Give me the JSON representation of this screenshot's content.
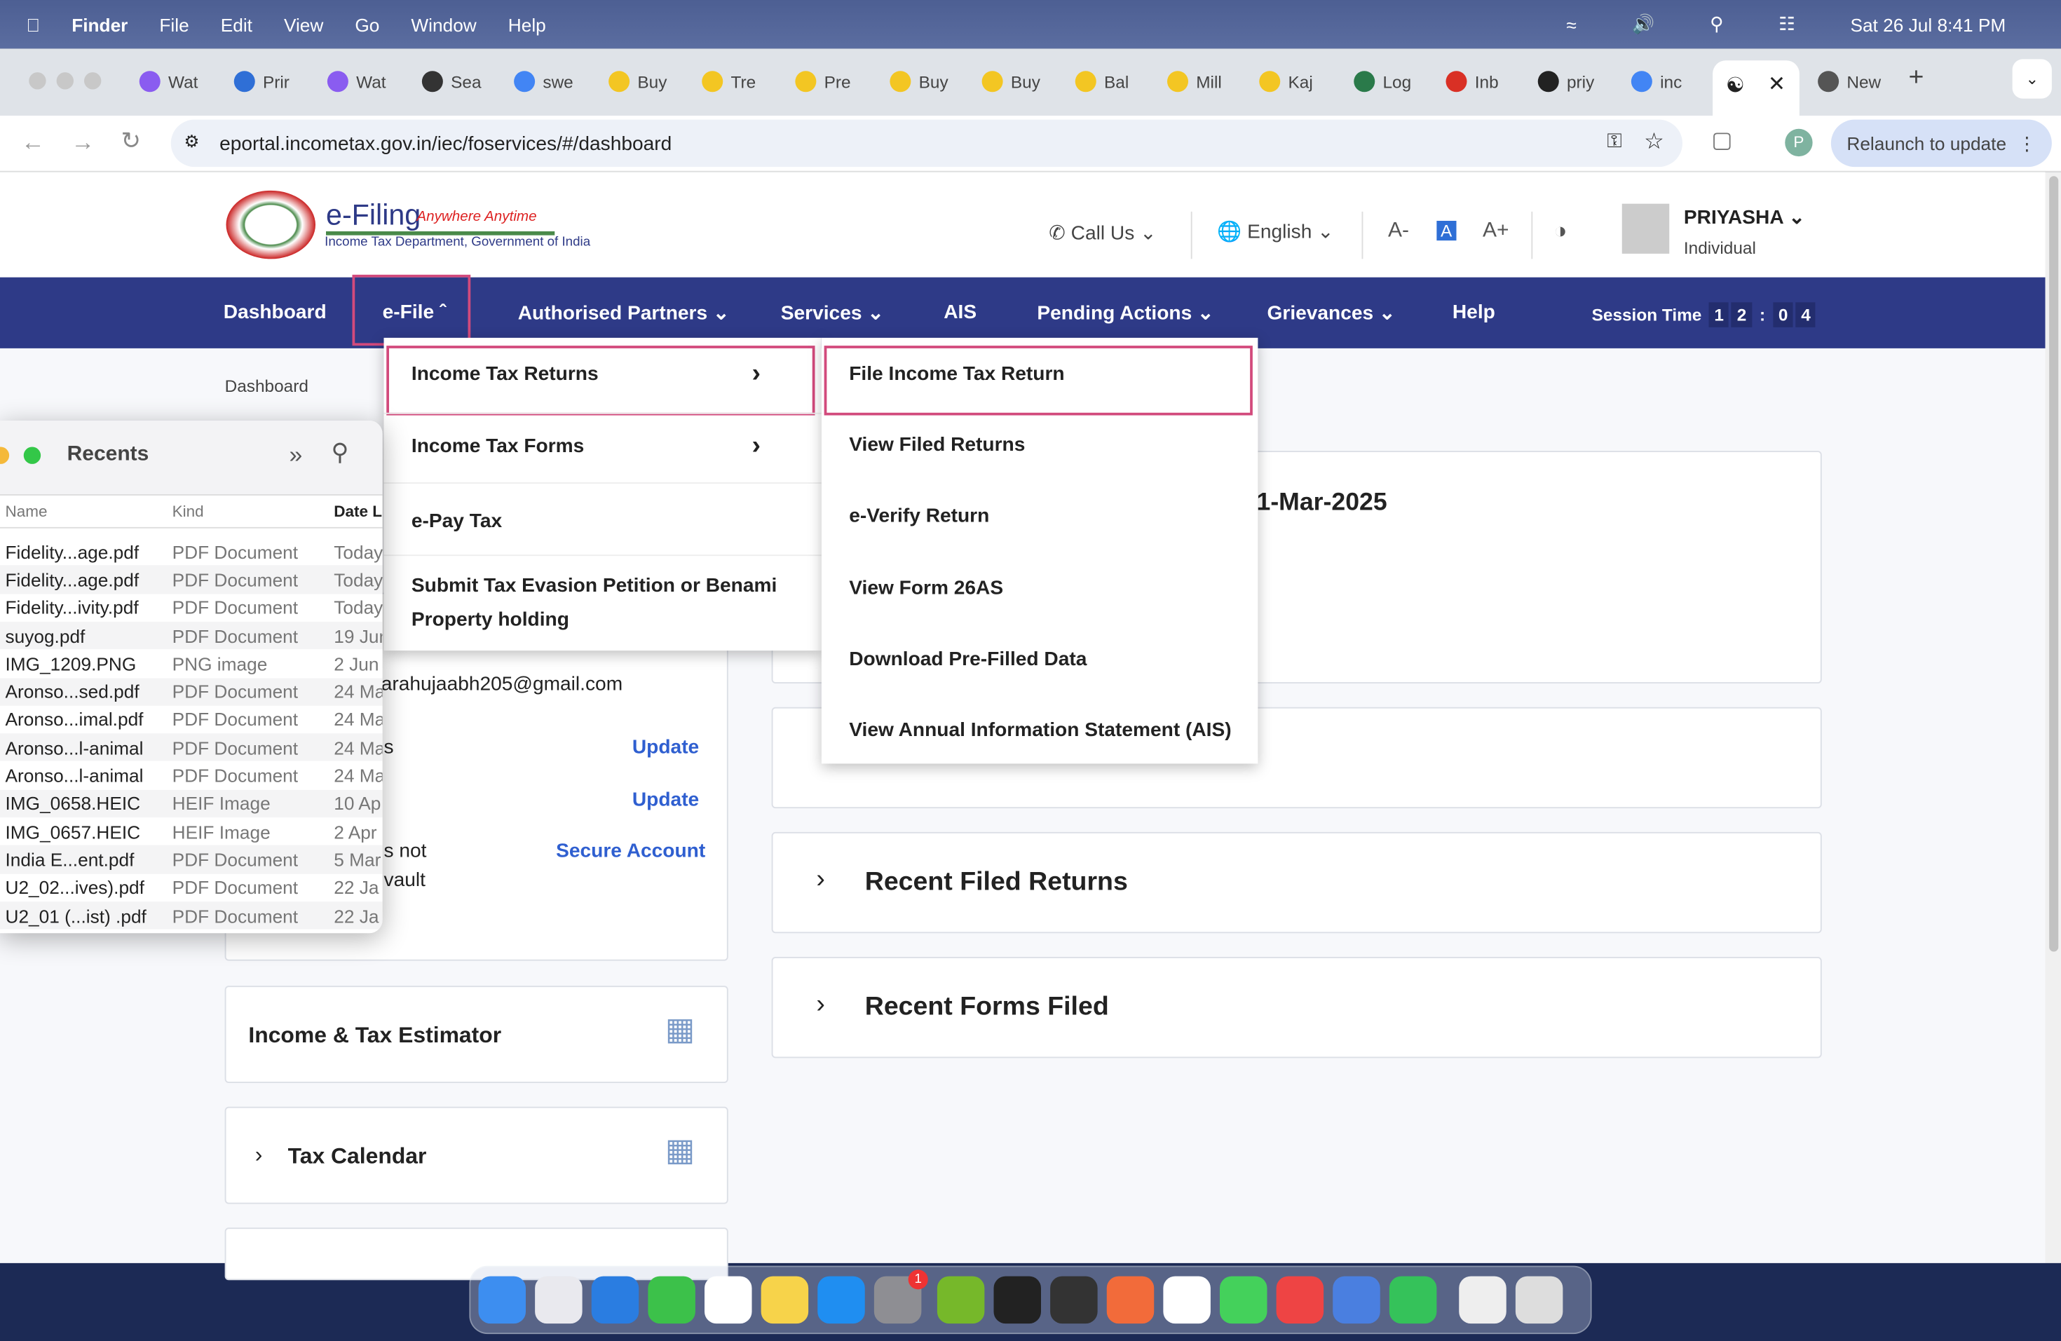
{
  "menubar": {
    "app": "Finder",
    "items": [
      "File",
      "Edit",
      "View",
      "Go",
      "Window",
      "Help"
    ],
    "datetime": "Sat 26 Jul  8:41 PM"
  },
  "tabs": [
    "Wat",
    "Prir",
    "Wat",
    "Sea",
    "swe",
    "Buy",
    "Tre",
    "Pre",
    "Buy",
    "Buy",
    "Bal",
    "Mill",
    "Kaj",
    "Log",
    "Inb",
    "priy",
    "inc",
    "New"
  ],
  "browser": {
    "url": "eportal.incometax.gov.in/iec/foservices/#/dashboard",
    "relaunch": "Relaunch to update",
    "profile": "P",
    "new_tab": "+"
  },
  "header": {
    "logo_title": "e-Filing",
    "logo_tagline": "Anywhere Anytime",
    "logo_sub": "Income Tax Department, Government of India",
    "call_us": "Call Us",
    "language": "English",
    "font_dec": "A-",
    "font_norm": "A",
    "font_inc": "A+",
    "user_name": "PRIYASHA",
    "user_type": "Individual"
  },
  "nav": {
    "items": [
      "Dashboard",
      "e-File",
      "Authorised Partners",
      "Services",
      "AIS",
      "Pending Actions",
      "Grievances",
      "Help"
    ],
    "session_label": "Session Time",
    "session_digits": [
      "1",
      "2",
      ":",
      "0",
      "4"
    ]
  },
  "breadcrumb": "Dashboard",
  "efile_menu": [
    "Income Tax Returns",
    "Income Tax Forms",
    "e-Pay Tax",
    "Submit Tax Evasion Petition or Benami",
    "Property holding"
  ],
  "itr_submenu": [
    "File Income Tax Return",
    "View Filed Returns",
    "e-Verify Return",
    "View Form 26AS",
    "Download Pre-Filled Data",
    "View Annual Information Statement (AIS)"
  ],
  "profile_card": {
    "email": "arahujaabh205@gmail.com",
    "frag1": "s",
    "frag2": "s not",
    "frag3": "vault",
    "update1": "Update",
    "update2": "Update",
    "secure": "Secure Account"
  },
  "right_cards": {
    "date_fragment": "1-Mar-2025",
    "recent_returns": "Recent Filed Returns",
    "recent_forms": "Recent Forms Filed"
  },
  "left_cards": {
    "estimator": "Income & Tax Estimator",
    "calendar": "Tax Calendar"
  },
  "finder": {
    "title": "Recents",
    "columns": [
      "Name",
      "Kind",
      "Date L"
    ],
    "rows": [
      [
        "Fidelity...age.pdf",
        "PDF Document",
        "Today"
      ],
      [
        "Fidelity...age.pdf",
        "PDF Document",
        "Today"
      ],
      [
        "Fidelity...ivity.pdf",
        "PDF Document",
        "Today"
      ],
      [
        "suyog.pdf",
        "PDF Document",
        "19 Jun"
      ],
      [
        "IMG_1209.PNG",
        "PNG image",
        "2 Jun"
      ],
      [
        "Aronso...sed.pdf",
        "PDF Document",
        "24 Ma"
      ],
      [
        "Aronso...imal.pdf",
        "PDF Document",
        "24 Ma"
      ],
      [
        "Aronso...l-animal",
        "PDF Document",
        "24 Ma"
      ],
      [
        "Aronso...l-animal",
        "PDF Document",
        "24 Ma"
      ],
      [
        "IMG_0658.HEIC",
        "HEIF Image",
        "10 Ap"
      ],
      [
        "IMG_0657.HEIC",
        "HEIF Image",
        "2 Apr"
      ],
      [
        "India E...ent.pdf",
        "PDF Document",
        "5 Mar"
      ],
      [
        "U2_02...ives).pdf",
        "PDF Document",
        "22 Ja"
      ],
      [
        "U2_01 (...ist) .pdf",
        "PDF Document",
        "22 Ja"
      ]
    ]
  },
  "dock": {
    "badge": "1"
  },
  "colors": {
    "nav": "#2e3a87",
    "highlight": "#d24a7c",
    "link": "#2f5fd0"
  }
}
